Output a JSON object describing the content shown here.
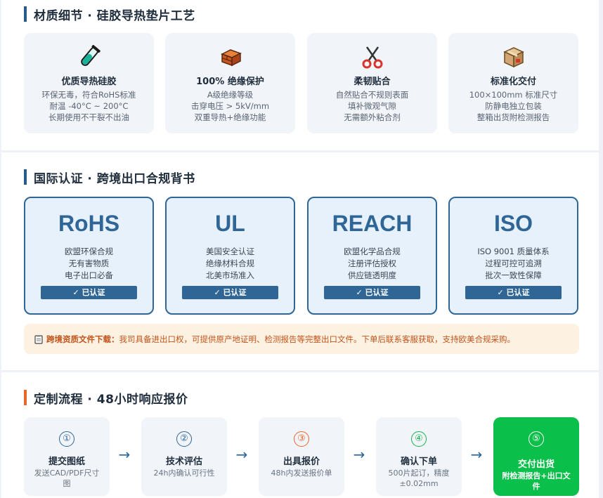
{
  "materials": {
    "title": "材质细节 · 硅胶导热垫片工艺",
    "cards": [
      {
        "icon": "test-tube-icon",
        "title": "优质导热硅胶",
        "lines": [
          "环保无毒，符合RoHS标准",
          "耐温 -40°C ~ 200°C",
          "长期使用不干裂不出油"
        ]
      },
      {
        "icon": "brick-icon",
        "title": "100% 绝缘保护",
        "lines": [
          "A级绝缘等级",
          "击穿电压 > 5kV/mm",
          "双重导热+绝缘功能"
        ]
      },
      {
        "icon": "scissors-icon",
        "title": "柔韧贴合",
        "lines": [
          "自然贴合不规则表面",
          "填补微观气隙",
          "无需额外粘合剂"
        ]
      },
      {
        "icon": "package-icon",
        "title": "标准化交付",
        "lines": [
          "100×100mm 标准尺寸",
          "防静电独立包装",
          "整箱出货附检测报告"
        ]
      }
    ]
  },
  "certs": {
    "title": "国际认证 · 跨境出口合规背书",
    "cards": [
      {
        "name": "RoHS",
        "lines": [
          "欧盟环保合规",
          "无有害物质",
          "电子出口必备"
        ],
        "badge": "✓ 已认证"
      },
      {
        "name": "UL",
        "lines": [
          "美国安全认证",
          "绝缘材料合规",
          "北美市场准入"
        ],
        "badge": "✓ 已认证"
      },
      {
        "name": "REACH",
        "lines": [
          "欧盟化学品合规",
          "注册评估授权",
          "供应链透明度"
        ],
        "badge": "✓ 已认证"
      },
      {
        "name": "ISO",
        "lines": [
          "ISO 9001 质量体系",
          "过程可控可追溯",
          "批次一致性保障"
        ],
        "badge": "✓ 已认证"
      }
    ],
    "notice": {
      "label": "跨境资质文件下载：",
      "text": "我司具备进出口权，可提供原产地证明、检测报告等完整出口文件。下单后联系客服获取，支持欧美合规采购。"
    }
  },
  "process": {
    "title": "定制流程 · 48小时响应报价",
    "arrow": "→",
    "steps": [
      {
        "num": "①",
        "title": "提交图纸",
        "desc": "发送CAD/PDF尺寸图"
      },
      {
        "num": "②",
        "title": "技术评估",
        "desc": "24h内确认可行性"
      },
      {
        "num": "③",
        "title": "出具报价",
        "desc": "48h内发送报价单"
      },
      {
        "num": "④",
        "title": "确认下单",
        "desc": "500片起订，精度±0.02mm"
      },
      {
        "num": "⑤",
        "title": "交付出货",
        "desc": "附检测报告+出口文件"
      }
    ]
  },
  "colors": {
    "primary": "#2f6696",
    "accent_orange": "#e8662b",
    "accent_green": "#0ac04a",
    "notice_bg": "#fdf2e1"
  }
}
